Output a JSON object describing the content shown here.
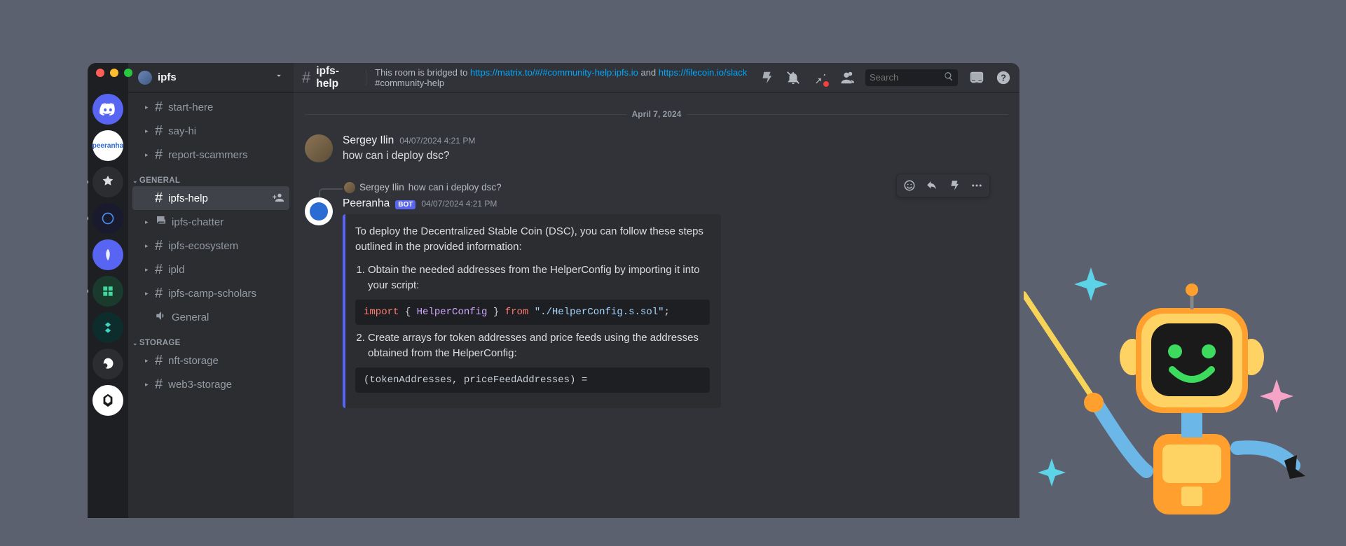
{
  "server": {
    "name": "ipfs"
  },
  "categories": [
    {
      "name": null,
      "channels": [
        {
          "label": "start-here",
          "type": "text"
        },
        {
          "label": "say-hi",
          "type": "text"
        },
        {
          "label": "report-scammers",
          "type": "text"
        }
      ]
    },
    {
      "name": "GENERAL",
      "channels": [
        {
          "label": "ipfs-help",
          "type": "text",
          "active": true
        },
        {
          "label": "ipfs-chatter",
          "type": "forum"
        },
        {
          "label": "ipfs-ecosystem",
          "type": "text"
        },
        {
          "label": "ipld",
          "type": "text"
        },
        {
          "label": "ipfs-camp-scholars",
          "type": "text"
        },
        {
          "label": "General",
          "type": "voice"
        }
      ]
    },
    {
      "name": "STORAGE",
      "channels": [
        {
          "label": "nft-storage",
          "type": "text"
        },
        {
          "label": "web3-storage",
          "type": "text"
        }
      ]
    }
  ],
  "header": {
    "channel": "ipfs-help",
    "topic_prefix": "This room is bridged to ",
    "topic_link1": "https://matrix.to/#/#community-help:ipfs.io",
    "topic_mid": " and ",
    "topic_link2": "https://filecoin.io/slack",
    "topic_suffix": " #community-help",
    "search_placeholder": "Search"
  },
  "date_divider": "April 7, 2024",
  "messages": {
    "m1": {
      "author": "Sergey Ilin",
      "timestamp": "04/07/2024 4:21 PM",
      "text": "how can i deploy dsc?"
    },
    "m2": {
      "reply_author": "Sergey Ilin",
      "reply_text": "how can i deploy dsc?",
      "author": "Peeranha",
      "bot_tag": "BOT",
      "timestamp": "04/07/2024 4:21 PM",
      "embed": {
        "intro": "To deploy the Decentralized Stable Coin (DSC), you can follow these steps outlined in the provided information:",
        "step1": "Obtain the needed addresses from the HelperConfig by importing it into your script:",
        "code1_kw1": "import",
        "code1_brace1": "{",
        "code1_type": "HelperConfig",
        "code1_brace2": "}",
        "code1_kw2": "from",
        "code1_str": "\"./HelperConfig.s.sol\"",
        "code1_semi": ";",
        "step2": "Create arrays for token addresses and price feeds using the addresses obtained from the HelperConfig:",
        "code2": "(tokenAddresses, priceFeedAddresses) ="
      }
    }
  },
  "servers": [
    {
      "name": "discord-home",
      "class": "discord"
    },
    {
      "name": "peeranha",
      "class": "peeranha",
      "label": "peeranha"
    },
    {
      "name": "server-3",
      "class": "dark"
    },
    {
      "name": "server-4",
      "class": "navy"
    },
    {
      "name": "server-5",
      "class": "blue"
    },
    {
      "name": "server-6",
      "class": "green"
    },
    {
      "name": "server-7",
      "class": "teal"
    },
    {
      "name": "server-8",
      "class": "dark"
    },
    {
      "name": "server-9",
      "class": "white"
    }
  ]
}
